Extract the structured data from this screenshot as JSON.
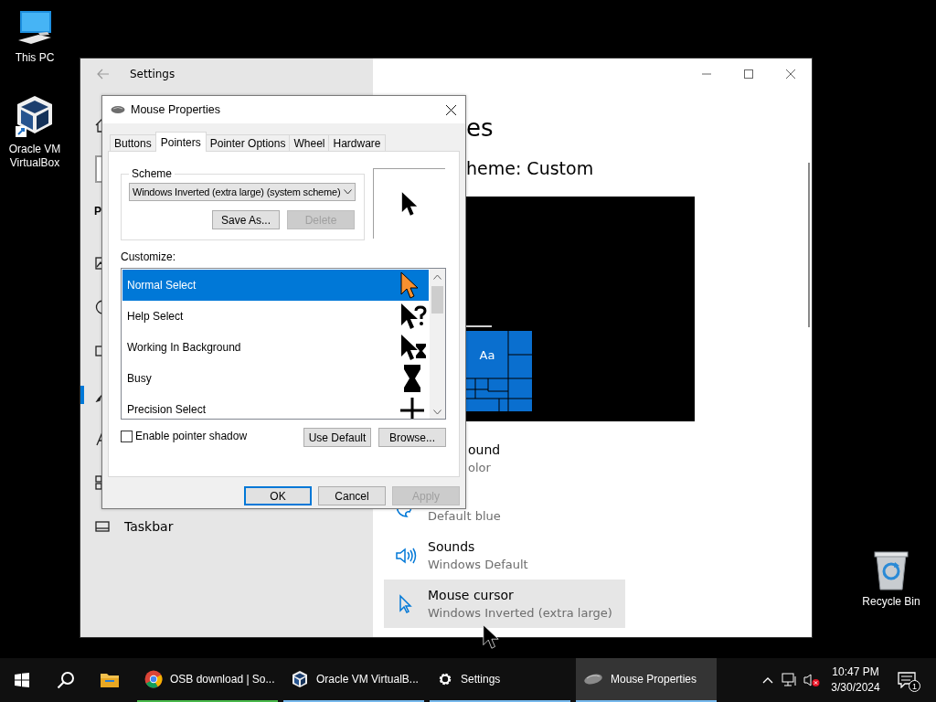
{
  "desktop_icons": [
    {
      "kind": "computer",
      "label": "This PC"
    },
    {
      "kind": "virtualbox",
      "label": "Oracle VM VirtualBox"
    },
    {
      "kind": "recycle-bin",
      "label": "Recycle Bin"
    }
  ],
  "settings_window": {
    "title": "Settings",
    "sidebar": {
      "heading": "P",
      "items": [
        {
          "kind": "picture",
          "selected": false
        },
        {
          "kind": "palette",
          "selected": false
        },
        {
          "kind": "monitor",
          "selected": false
        },
        {
          "kind": "brush",
          "selected": true
        },
        {
          "kind": "font",
          "selected": false
        },
        {
          "kind": "start",
          "selected": false
        },
        {
          "kind": "taskbar",
          "label": "Taskbar",
          "selected": false
        }
      ]
    },
    "content": {
      "heading": "es",
      "subheading": "heme: Custom",
      "tile_text": "Aa",
      "options": [
        {
          "kind": "none",
          "title": "ound",
          "subtitle": "olor",
          "selected": false
        },
        {
          "kind": "palette",
          "subtitle": "Default blue",
          "selected": false
        },
        {
          "kind": "speaker",
          "title": "Sounds",
          "subtitle": "Windows Default",
          "selected": false
        },
        {
          "kind": "cursor",
          "title": "Mouse cursor",
          "subtitle": "Windows Inverted (extra large)",
          "selected": true
        }
      ]
    }
  },
  "dialog": {
    "title": "Mouse Properties",
    "tabs": [
      {
        "label": "Buttons",
        "selected": false
      },
      {
        "label": "Pointers",
        "selected": true
      },
      {
        "label": "Pointer Options",
        "selected": false
      },
      {
        "label": "Wheel",
        "selected": false
      },
      {
        "label": "Hardware",
        "selected": false
      }
    ],
    "scheme": {
      "label": "Scheme",
      "value": "Windows Inverted (extra large) (system scheme)",
      "buttons": [
        {
          "label": "Save As...",
          "disabled": false
        },
        {
          "label": "Delete",
          "disabled": true
        }
      ]
    },
    "customize_label": "Customize:",
    "pointers": [
      {
        "kind": "arrow",
        "name": "Normal Select",
        "selected": true
      },
      {
        "kind": "help",
        "name": "Help Select",
        "selected": false
      },
      {
        "kind": "working",
        "name": "Working In Background",
        "selected": false
      },
      {
        "kind": "busy",
        "name": "Busy",
        "selected": false
      },
      {
        "kind": "precision",
        "name": "Precision Select",
        "selected": false
      }
    ],
    "shadow": {
      "label": "Enable pointer shadow",
      "checked": false
    },
    "list_buttons": [
      {
        "label": "Use Default",
        "disabled": false
      },
      {
        "label": "Browse...",
        "disabled": false
      }
    ],
    "buttons": [
      {
        "label": "OK",
        "default": true,
        "disabled": false
      },
      {
        "label": "Cancel",
        "default": false,
        "disabled": false
      },
      {
        "label": "Apply",
        "default": false,
        "disabled": true
      }
    ]
  },
  "taskbar": {
    "apps": [
      {
        "kind": "chrome",
        "label": "OSB download | So...",
        "selected": false,
        "color": "#48b84a"
      },
      {
        "kind": "virtualbox",
        "label": "Oracle VM VirtualB...",
        "selected": false,
        "color": "#76b9ed"
      },
      {
        "kind": "gear",
        "label": "Settings",
        "selected": false,
        "color": "#76b9ed"
      },
      {
        "kind": "mouse",
        "label": "Mouse Properties",
        "selected": true,
        "color": "#76b9ed"
      }
    ],
    "time": "10:47 PM",
    "date": "3/30/2024",
    "notification_count": "1"
  }
}
